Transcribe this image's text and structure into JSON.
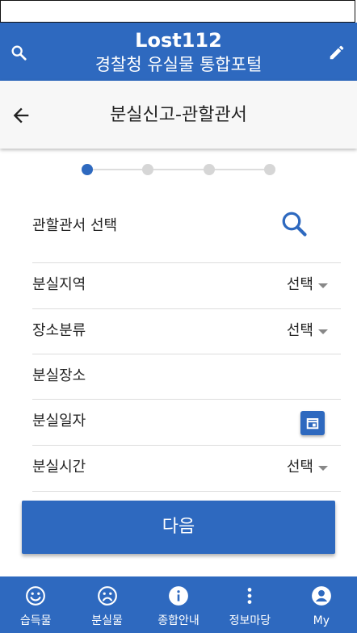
{
  "header": {
    "title": "Lost112",
    "subtitle": "경찰청 유실물 통합포털"
  },
  "subbar": {
    "title": "분실신고-관할관서"
  },
  "stepper": {
    "total_steps": 4,
    "current_step": 1
  },
  "form": {
    "station_label": "관할관서 선택",
    "region_label": "분실지역",
    "region_value": "선택",
    "place_type_label": "장소분류",
    "place_type_value": "선택",
    "place_label": "분실장소",
    "date_label": "분실일자",
    "time_label": "분실시간",
    "time_value": "선택"
  },
  "next_button": "다음",
  "bottom_nav": [
    {
      "label": "습득물",
      "icon": "smile-icon"
    },
    {
      "label": "분실물",
      "icon": "sad-face-icon"
    },
    {
      "label": "종합안내",
      "icon": "info-icon"
    },
    {
      "label": "정보마당",
      "icon": "more-vert-icon"
    },
    {
      "label": "My",
      "icon": "account-icon"
    }
  ],
  "colors": {
    "primary": "#2e69bf",
    "subbar_bg": "#f7f7f7",
    "divider": "#dddddd"
  }
}
